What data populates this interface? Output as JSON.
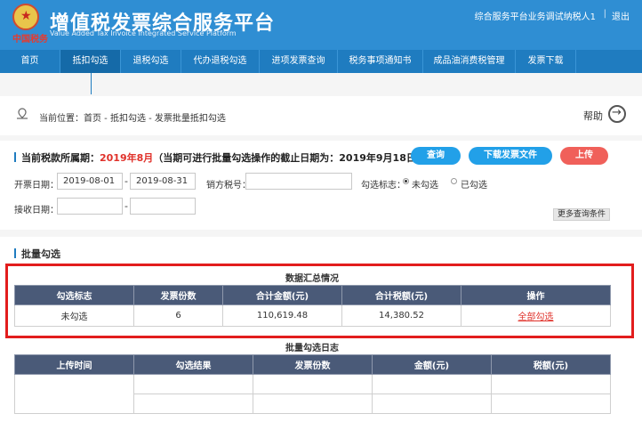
{
  "header": {
    "title": "增值税发票综合服务平台",
    "subtitle": "Value Added Tax Invoice Integrated Service Platform",
    "brand_text": "中国税务",
    "user": "综合服务平台业务调试纳税人1",
    "separator": "|",
    "logout": "退出"
  },
  "nav": {
    "items": [
      "首页",
      "抵扣勾选",
      "退税勾选",
      "代办退税勾选",
      "进项发票查询",
      "税务事项通知书",
      "成品油消费税管理",
      "发票下载"
    ],
    "active_index": 1
  },
  "breadcrumb": {
    "text": "当前位置：首页 - 抵扣勾选 - 发票批量抵扣勾选",
    "help": "帮助"
  },
  "query": {
    "period_label": "当前税款所属期：",
    "period_value": "2019年8月",
    "period_note": "（当期可进行批量勾选操作的截止日期为：2019年9月18日）",
    "btn_query": "查询",
    "btn_download": "下载发票文件",
    "btn_upload": "上传",
    "invoice_date_label": "开票日期：",
    "date_from": "2019-08-01",
    "date_to": "2019-08-31",
    "seller_label": "销方税号：",
    "seller_value": "",
    "check_flag_label": "勾选标志：",
    "opt_unchecked": "未勾选",
    "opt_checked": "已勾选",
    "receive_label": "接收日期：",
    "receive_from": "",
    "receive_to": "",
    "more": "更多查询条件"
  },
  "batch": {
    "title": "批量勾选",
    "summary_caption": "数据汇总情况",
    "summary_headers": [
      "勾选标志",
      "发票份数",
      "合计金额(元)",
      "合计税额(元)",
      "操作"
    ],
    "summary_row": {
      "flag": "未勾选",
      "count": "6",
      "amount": "110,619.48",
      "tax": "14,380.52",
      "action": "全部勾选"
    },
    "log_caption": "批量勾选日志",
    "log_headers": [
      "上传时间",
      "勾选结果",
      "发票份数",
      "金额(元)",
      "税额(元)"
    ]
  },
  "colors": {
    "header_blue": "#2f8ed3",
    "nav_blue": "#1f7cc0",
    "button_blue": "#22a0e8",
    "button_red": "#f0605a",
    "highlight_red": "#e21d1d",
    "table_header": "#4a5a78"
  }
}
